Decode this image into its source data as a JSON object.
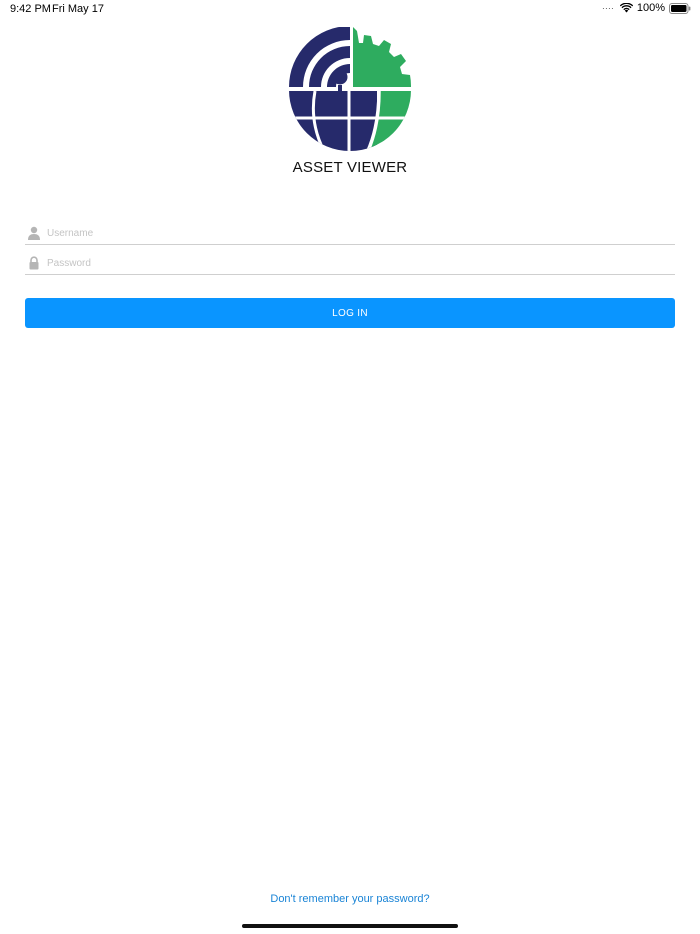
{
  "status_bar": {
    "time": "9:42 PM",
    "date": "Fri May 17",
    "battery": "100%",
    "icons": [
      "signal-dots-icon",
      "wifi-icon",
      "battery-icon"
    ]
  },
  "logo": {
    "icon": "globe-gear-logo",
    "colors": {
      "navy": "#262a6b",
      "green": "#2eac5f"
    }
  },
  "app_title": "ASSET VIEWER",
  "form": {
    "username": {
      "icon": "user-icon",
      "placeholder": "Username",
      "value": ""
    },
    "password": {
      "icon": "lock-icon",
      "placeholder": "Password",
      "value": ""
    },
    "login_label": "LOG IN",
    "login_color": "#0a95ff"
  },
  "forgot_password": "Don't remember your password?"
}
